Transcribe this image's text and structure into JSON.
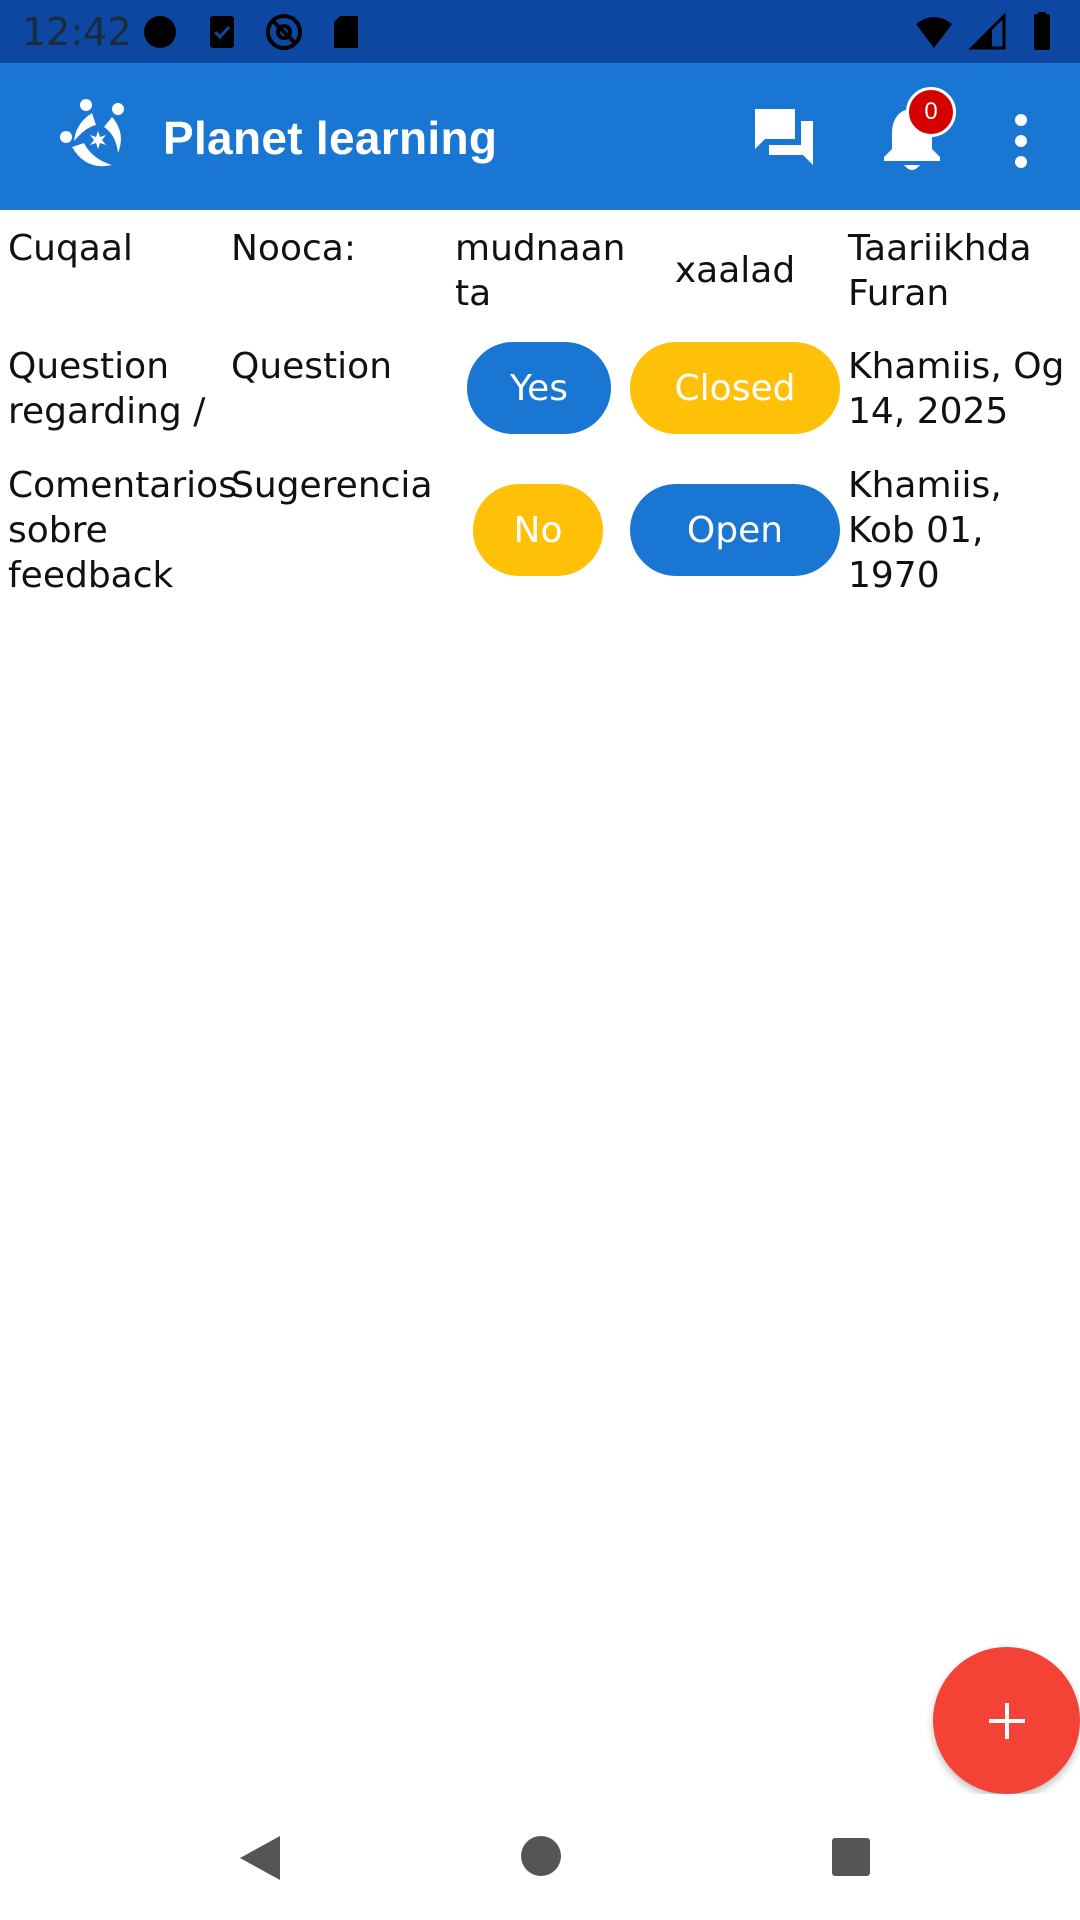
{
  "status_bar": {
    "time": "12:42",
    "icons_left": [
      "record-dot-icon",
      "task-check-icon",
      "at-sign-icon",
      "sd-card-icon"
    ],
    "icons_right": [
      "wifi-icon",
      "signal-icon",
      "battery-icon"
    ]
  },
  "app_bar": {
    "title": "Planet learning",
    "notification_count": "0",
    "bg_color": "#1976d2"
  },
  "table": {
    "headers": {
      "title": "Cuqaal",
      "type": "Nooca:",
      "priority": "mudnaan ta",
      "status": "xaalad",
      "date": "Taariikhda Furan"
    },
    "rows": [
      {
        "title": "Question regarding /",
        "type": "Question",
        "priority": "Yes",
        "status": "Closed",
        "date": "Khamiis, Og 14, 2025"
      },
      {
        "title": "Comentarios sobre feedback",
        "type": "Sugerencia",
        "priority": "No",
        "status": "Open",
        "date": "Khamiis, Kob 01, 1970"
      }
    ]
  },
  "colors": {
    "pill_blue": "#1976d2",
    "pill_yellow": "#ffc107",
    "fab": "#f44336",
    "badge": "#d50000"
  },
  "fab": {
    "icon": "plus-icon"
  }
}
